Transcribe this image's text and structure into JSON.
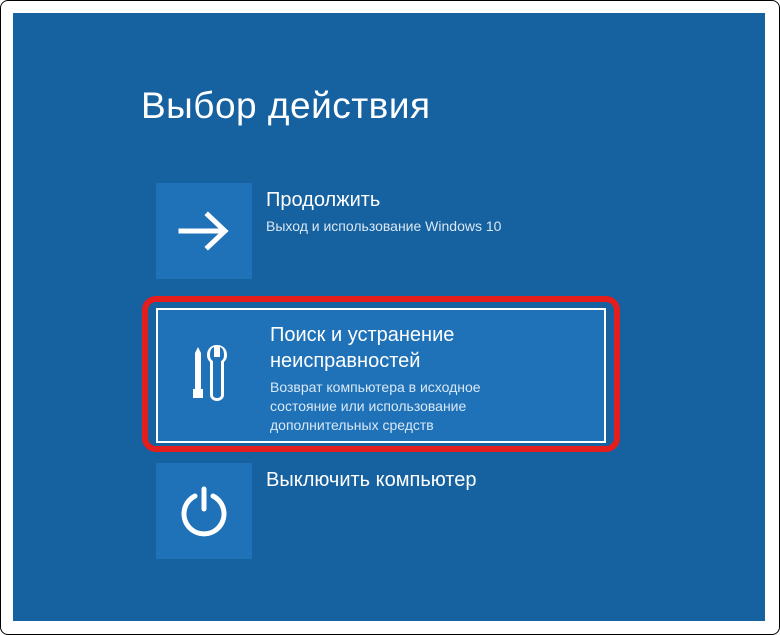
{
  "title": "Выбор действия",
  "tiles": {
    "continue": {
      "title": "Продолжить",
      "desc": "Выход и использование Windows 10"
    },
    "troubleshoot": {
      "title": "Поиск и устранение неисправностей",
      "desc": "Возврат компьютера в исходное состояние или использование дополнительных средств"
    },
    "power": {
      "title": "Выключить компьютер"
    }
  }
}
